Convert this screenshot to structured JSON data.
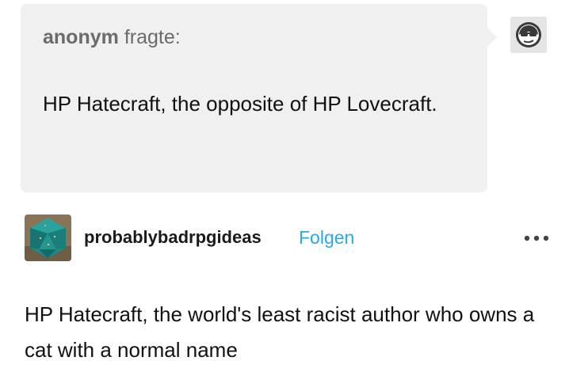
{
  "ask": {
    "asker": "anonym",
    "verb": "fragte:",
    "question": "HP Hatecraft, the opposite of HP Lovecraft.",
    "avatar_icon": "anonymous-sunglasses-icon"
  },
  "post": {
    "blog_name": "probablybadrpgideas",
    "follow_label": "Folgen",
    "avatar_icon": "teal-d20-dice-image",
    "more_icon": "more-dots-icon",
    "answer": "HP Hatecraft, the world's least racist author who owns a cat with a normal name"
  },
  "colors": {
    "bubble_bg": "#f0f0f0",
    "asker_text": "#6b6b6b",
    "follow_link": "#2aa8e0",
    "body_text": "#111111"
  }
}
